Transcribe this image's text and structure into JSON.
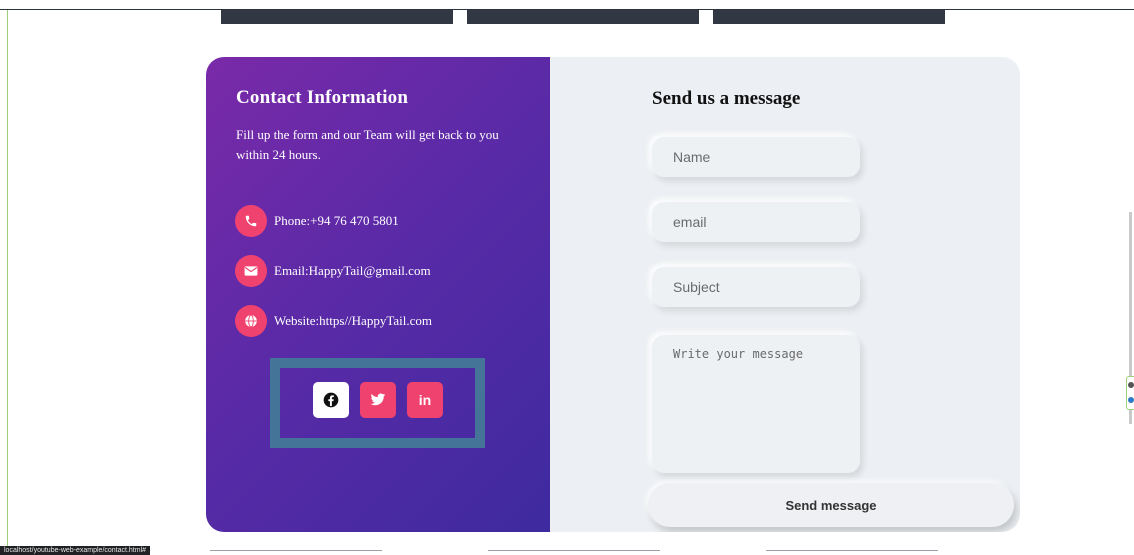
{
  "contact_info": {
    "title": "Contact Information",
    "description": "Fill up the form and our Team will get back to you within 24 hours.",
    "items": [
      {
        "icon": "phone-icon",
        "text": "Phone:+94 76 470 5801"
      },
      {
        "icon": "envelope-icon",
        "text": "Email:HappyTail@gmail.com"
      },
      {
        "icon": "globe-icon",
        "text": "Website:https//HappyTail.com"
      }
    ],
    "social": [
      {
        "icon": "facebook-icon"
      },
      {
        "icon": "twitter-icon"
      },
      {
        "icon": "linkedin-icon",
        "label": "in"
      }
    ]
  },
  "form": {
    "title": "Send us a message",
    "name_placeholder": "Name",
    "email_placeholder": "email",
    "subject_placeholder": "Subject",
    "message_placeholder": "Write your message",
    "submit_label": "Send message"
  },
  "status_bar": {
    "url": "localhost/youtube-web-example/contact.html#"
  },
  "colors": {
    "accent": "#f0426f",
    "panel_gradient_start": "#7a2aa8",
    "panel_gradient_end": "#3e2a9f",
    "highlight_border": "#447599",
    "form_background": "#eceff3"
  }
}
